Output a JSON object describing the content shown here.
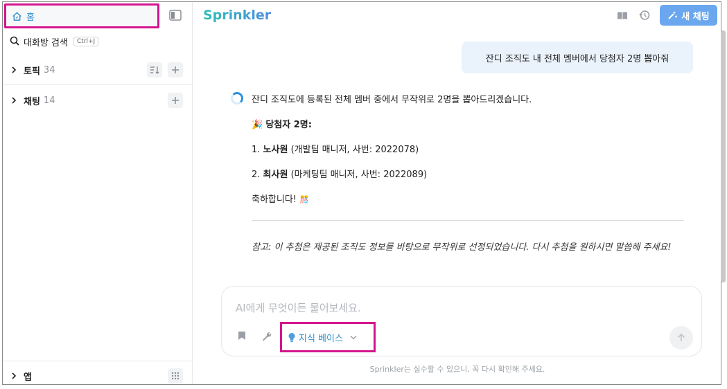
{
  "sidebar": {
    "home_label": "홈",
    "search_label": "대화방 검색",
    "search_shortcut": "Ctrl+J",
    "topics": {
      "label": "토픽",
      "count": "34"
    },
    "chats": {
      "label": "채팅",
      "count": "14"
    },
    "apps": {
      "label": "앱"
    }
  },
  "header": {
    "brand": "Sprinkler",
    "new_chat_label": "새 채팅"
  },
  "conversation": {
    "user_message": "잔디 조직도 내 전체 멤버에서 당첨자 2명 뽑아줘",
    "assistant": {
      "intro": "잔디 조직도에 등록된 전체 멤버 중에서 무작위로 2명을 뽑아드리겠습니다.",
      "winners_emoji": "🎉",
      "winners_title": "당첨자 2명:",
      "winner1_num": "1.",
      "winner1_name": "노사원",
      "winner1_detail": "(개발팀 매니저, 사번: 2022078)",
      "winner2_num": "2.",
      "winner2_name": "최사원",
      "winner2_detail": "(마케팅팀 매니저, 사번: 2022089)",
      "congrats": "축하합니다!",
      "congrats_emoji": "🎊",
      "note": "참고: 이 추첨은 제공된 조직도 정보를 바탕으로 무작위로 선정되었습니다. 다시 추첨을 원하시면 말씀해 주세요!"
    }
  },
  "composer": {
    "placeholder": "AI에게 무엇이든 물어보세요.",
    "knowledge_base_label": "지식 베이스"
  },
  "disclaimer": "Sprinkler는 실수할 수 있으니, 꼭 다시 확인해 주세요.",
  "colors": {
    "accent": "#2f8fd0",
    "highlight_border": "#d4148e",
    "new_chat_bg": "#6aa7ef",
    "user_bubble_bg": "#eaf2fb"
  }
}
